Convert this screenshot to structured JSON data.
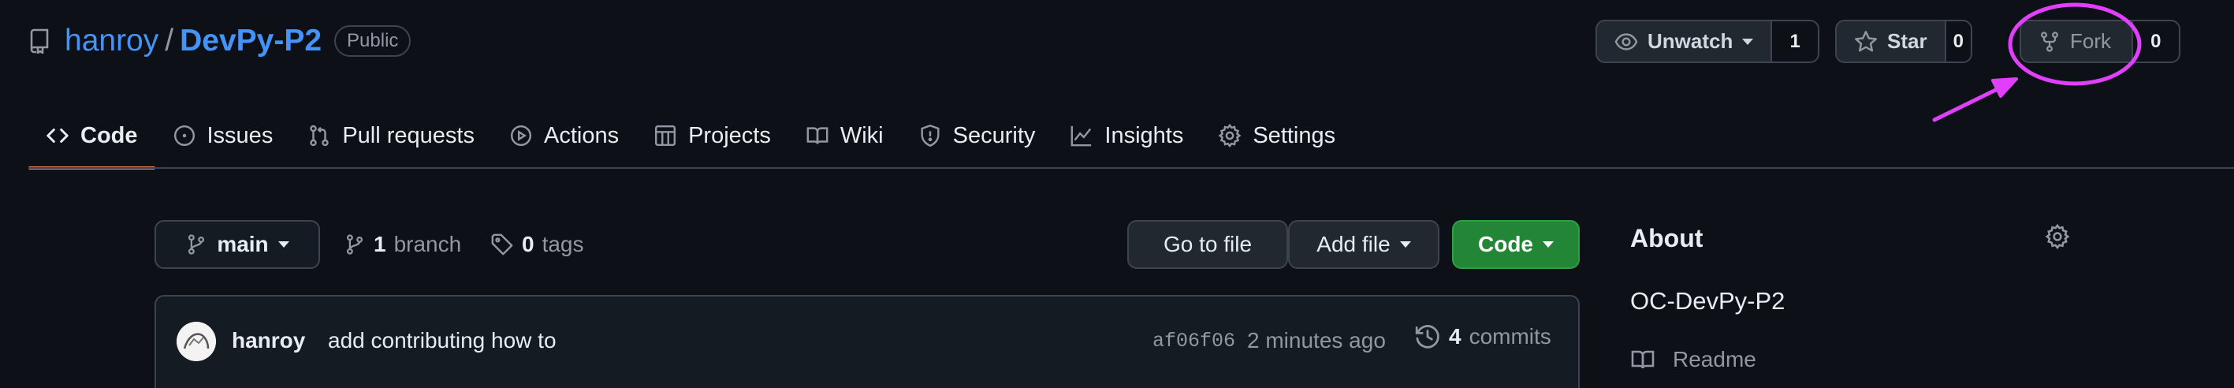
{
  "repo": {
    "owner": "hanroy",
    "separator": "/",
    "name": "DevPy-P2",
    "visibility": "Public"
  },
  "actions": {
    "watch": {
      "label": "Unwatch",
      "count": "1"
    },
    "star": {
      "label": "Star",
      "count": "0"
    },
    "fork": {
      "label": "Fork",
      "count": "0"
    }
  },
  "tabs": [
    {
      "label": "Code",
      "icon": "code-icon",
      "active": true
    },
    {
      "label": "Issues",
      "icon": "issue-opened-icon"
    },
    {
      "label": "Pull requests",
      "icon": "git-pull-request-icon"
    },
    {
      "label": "Actions",
      "icon": "play-icon"
    },
    {
      "label": "Projects",
      "icon": "table-icon"
    },
    {
      "label": "Wiki",
      "icon": "book-icon"
    },
    {
      "label": "Security",
      "icon": "shield-icon"
    },
    {
      "label": "Insights",
      "icon": "graph-icon"
    },
    {
      "label": "Settings",
      "icon": "gear-icon"
    }
  ],
  "toolbar": {
    "branch": "main",
    "branch_count": "1",
    "branch_label": "branch",
    "tag_count": "0",
    "tag_label": "tags",
    "go_to_file": "Go to file",
    "add_file": "Add file",
    "code": "Code"
  },
  "commit": {
    "author": "hanroy",
    "message": "add contributing how to",
    "sha": "af06f06",
    "time": "2 minutes ago",
    "count": "4",
    "count_label": "commits"
  },
  "about": {
    "heading": "About",
    "description": "OC-DevPy-P2",
    "readme": "Readme"
  },
  "colors": {
    "background": "#0d1117",
    "link": "#4493f8",
    "active_tab_underline": "#f78166",
    "primary_button": "#238636",
    "annotation": "#e040fb"
  }
}
